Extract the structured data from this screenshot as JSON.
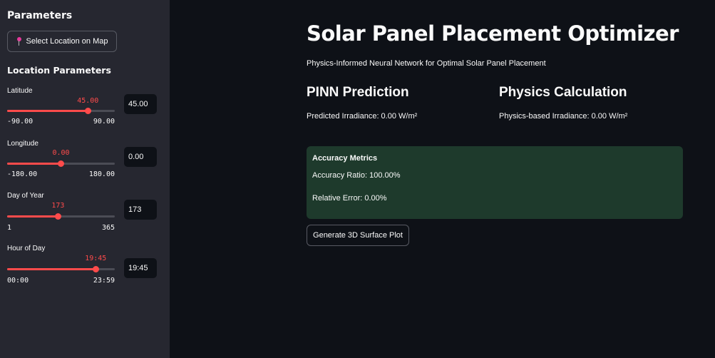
{
  "sidebar": {
    "title": "Parameters",
    "map_button": {
      "label": "Select Location on Map",
      "icon": "pin-icon"
    },
    "section_title": "Location Parameters",
    "sliders": [
      {
        "label": "Latitude",
        "value": "45.00",
        "min": "-90.00",
        "max": "90.00",
        "fraction": 0.75,
        "input": "45.00"
      },
      {
        "label": "Longitude",
        "value": "0.00",
        "min": "-180.00",
        "max": "180.00",
        "fraction": 0.5,
        "input": "0.00"
      },
      {
        "label": "Day of Year",
        "value": "173",
        "min": "1",
        "max": "365",
        "fraction": 0.4725,
        "input": "173"
      },
      {
        "label": "Hour of Day",
        "value": "19:45",
        "min": "00:00",
        "max": "23:59",
        "fraction": 0.823,
        "input": "19:45"
      }
    ]
  },
  "main": {
    "title": "Solar Panel Placement Optimizer",
    "subtitle": "Physics-Informed Neural Network for Optimal Solar Panel Placement",
    "pinn": {
      "heading": "PINN Prediction",
      "text": "Predicted Irradiance: 0.00 W/m²"
    },
    "physics": {
      "heading": "Physics Calculation",
      "text": "Physics-based Irradiance: 0.00 W/m²"
    },
    "metrics": {
      "title": "Accuracy Metrics",
      "accuracy": "Accuracy Ratio: 100.00%",
      "error": "Relative Error: 0.00%"
    },
    "generate_button": "Generate 3D Surface Plot"
  },
  "colors": {
    "accent": "#ff4b4b",
    "sidebar_bg": "#262730",
    "main_bg": "#0e1117",
    "metrics_bg": "#1e3a2c"
  }
}
